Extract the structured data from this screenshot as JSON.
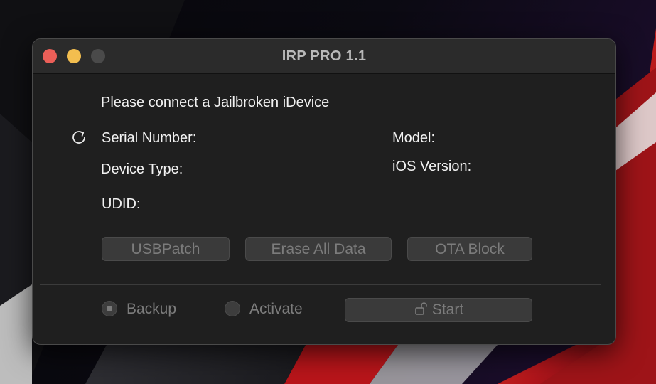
{
  "window": {
    "title": "IRP PRO 1.1"
  },
  "status": {
    "message": "Please connect a Jailbroken iDevice"
  },
  "device_info": {
    "serial_number_label": "Serial Number:",
    "model_label": "Model:",
    "device_type_label": "Device Type:",
    "ios_version_label": "iOS Version:",
    "udid_label": "UDID:"
  },
  "actions": {
    "usb_patch": "USBPatch",
    "erase_all_data": "Erase All Data",
    "ota_block": "OTA Block"
  },
  "mode": {
    "backup_label": "Backup",
    "activate_label": "Activate",
    "selected": "Backup"
  },
  "start": {
    "label": "Start"
  },
  "icons": {
    "refresh": "refresh-icon",
    "lock": "unlock-icon"
  },
  "colors": {
    "close": "#ec5f58",
    "minimize": "#f3be4f",
    "zoom_disabled": "#4a4a4a",
    "window_bg": "#1f1f1f",
    "disabled_text": "#7c7c7c"
  }
}
